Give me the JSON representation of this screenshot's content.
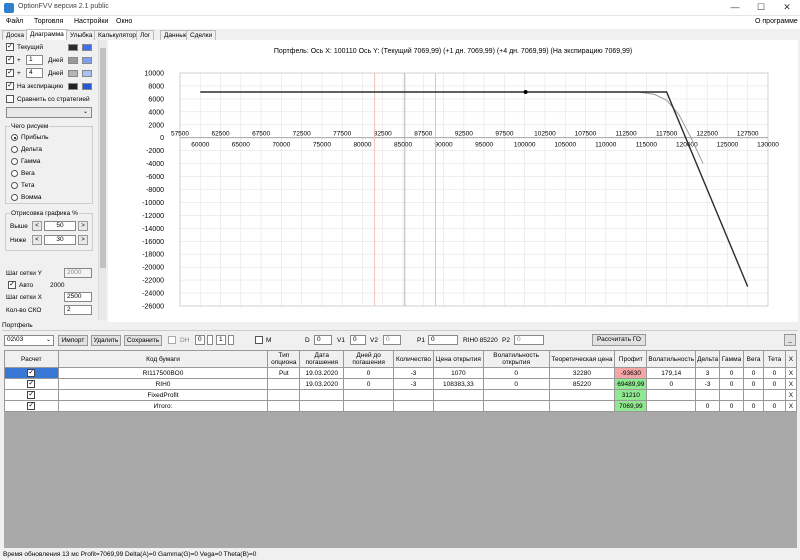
{
  "app": {
    "title": "OptionFVV версия 2.1 public",
    "min_glyph": "—",
    "max_glyph": "☐",
    "close_glyph": "✕"
  },
  "menu": {
    "file": "Файл",
    "trade": "Торговля",
    "settings": "Настройки",
    "window": "Окно",
    "about": "О программе"
  },
  "tabs": [
    "Доска",
    "Диаграмма",
    "Улыбка",
    "Калькулятор",
    "Лог",
    "Данные",
    "Сделки"
  ],
  "left": {
    "current": "Текущий",
    "plus1": "+",
    "days1_value": "1",
    "days_label": "Дней",
    "plus2": "+",
    "days2_value": "4",
    "expiration": "На экспирацию",
    "compare": "Сравнить со стратегией",
    "what_to_draw": "Чего рисуем",
    "radio": [
      "Прибыль",
      "Дельта",
      "Гамма",
      "Вега",
      "Тета",
      "Вомма"
    ],
    "draw_pct": "Отрисовка графика %",
    "above": "Выше",
    "above_value": "50",
    "below": "Ниже",
    "below_value": "30",
    "grid_y": "Шаг сетки Y",
    "grid_y_value": "2000",
    "auto": "Авто",
    "auto_value": "2000",
    "grid_x": "Шаг сетки X",
    "grid_x_value": "2500",
    "sko": "Кол-во СКО",
    "sko_value": "2",
    "spin_left": "<",
    "spin_right": ">",
    "check_mark": "✓",
    "dropdown_arrow": "⌄"
  },
  "chart_data": {
    "type": "line",
    "title": "Портфель:  Ось X:  100110  Ось Y:   (Текущий 7069,99)   (+1 дн. 7069,99)   (+4 дн. 7069,99)   (На экспирацию 7069,99)",
    "xlim": [
      57500,
      130000
    ],
    "ylim": [
      -26000,
      10000
    ],
    "x_ticks_top": [
      "57500",
      "62500",
      "67500",
      "72500",
      "77500",
      "82500",
      "87500",
      "92500",
      "97500",
      "102500",
      "107500",
      "112500",
      "117500",
      "122500",
      "127500"
    ],
    "x_ticks_bottom": [
      "60000",
      "65000",
      "70000",
      "75000",
      "80000",
      "85000",
      "90000",
      "95000",
      "100000",
      "105000",
      "110000",
      "115000",
      "120000",
      "125000",
      "130000"
    ],
    "y_ticks": [
      "10000",
      "8000",
      "6000",
      "4000",
      "2000",
      "0",
      "-2000",
      "-4000",
      "-6000",
      "-8000",
      "-10000",
      "-12000",
      "-14000",
      "-16000",
      "-18000",
      "-20000",
      "-22000",
      "-24000",
      "-26000"
    ],
    "series": [
      {
        "color": "#2b2b2b",
        "points": [
          [
            60000,
            7070
          ],
          [
            115000,
            7070
          ],
          [
            117500,
            7070
          ],
          [
            127500,
            -23000
          ]
        ]
      },
      {
        "color": "#9a9a9a",
        "points": [
          [
            60000,
            7070
          ],
          [
            114000,
            7060
          ],
          [
            116000,
            6700
          ],
          [
            117500,
            5800
          ],
          [
            119000,
            3600
          ],
          [
            120500,
            0
          ],
          [
            122000,
            -4000
          ]
        ]
      }
    ],
    "marker": [
      100110,
      7070
    ],
    "vlines": [
      {
        "x": 85220,
        "color": "#b0b0b0"
      },
      {
        "x": 81500,
        "color": "#f0b8b8"
      },
      {
        "x": 89000,
        "color": "#f0b8b8"
      }
    ]
  },
  "portfolio": {
    "section": "Портфель",
    "account": "02\\03",
    "import": "Импорт",
    "delete": "Удалить",
    "save": "Сохранить",
    "dh": "DH",
    "dh_v1": "0",
    "dh_v2": "1",
    "m": "M",
    "d": "D",
    "d_value": "0",
    "v1": "V1",
    "v1_value": "0",
    "v2": "V2",
    "v2_value": "0",
    "p1": "P1",
    "p1_value": "0",
    "rih": "RIH0 85220",
    "p2": "P2",
    "p2_value": "0",
    "calc_go": "Рассчитать ГО",
    "minimize": "_",
    "columns": [
      "Расчет",
      "Код бумаги",
      "Тип опциона",
      "Дата погашения",
      "Дней до погашения",
      "Количество",
      "Цена открытия",
      "Волатильность открытия",
      "Теоретическая цена",
      "Профит",
      "Волатильность",
      "Дельта",
      "Гамма",
      "Вега",
      "Тета",
      "X"
    ],
    "rows": [
      [
        "✓",
        "RI117500BO0",
        "Put",
        "19.03.2020",
        "0",
        "-3",
        "1070",
        "0",
        "32280",
        "-93630",
        "179,14",
        "3",
        "0",
        "0",
        "0",
        "X"
      ],
      [
        "✓",
        "RIH0",
        "",
        "19.03.2020",
        "0",
        "-3",
        "108383,33",
        "0",
        "85220",
        "69489,99",
        "0",
        "-3",
        "0",
        "0",
        "0",
        "X"
      ],
      [
        "✓",
        "FixedProfit",
        "",
        "",
        "",
        "",
        "",
        "",
        "",
        "31210",
        "",
        "",
        "",
        "",
        "",
        "X"
      ],
      [
        "✓",
        "Итого:",
        "",
        "",
        "",
        "",
        "",
        "",
        "",
        "7069,99",
        "",
        "0",
        "0",
        "0",
        "0",
        "X"
      ]
    ]
  },
  "status": "Время обновления 13 мс  Profit=7069,99 Delta(A)=0 Gamma(G)=0 Vega=0 Theta(B)=0",
  "colors": {
    "current": "#2b2b2b",
    "plus1": "#9a9a9a",
    "plus4": "#b5b5b5",
    "expiration": "#222222",
    "blue1": "#3f6fe6",
    "blue2": "#7aa0ef",
    "blue3": "#a7c2f2",
    "blue4": "#2458d8"
  }
}
